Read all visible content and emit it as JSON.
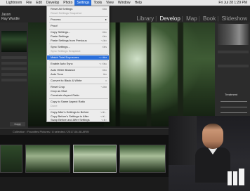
{
  "menubar": {
    "apple_glyph": "",
    "items": [
      {
        "label": "Lightroom",
        "active": false
      },
      {
        "label": "File",
        "active": false
      },
      {
        "label": "Edit",
        "active": false
      },
      {
        "label": "Develop",
        "active": false
      },
      {
        "label": "Photo",
        "active": false
      },
      {
        "label": "Settings",
        "active": true
      },
      {
        "label": "Tools",
        "active": false
      },
      {
        "label": "View",
        "active": false
      },
      {
        "label": "Window",
        "active": false
      },
      {
        "label": "Help",
        "active": false
      }
    ],
    "clock": "Fri Jul 28 1:29 PM"
  },
  "identity_plate": {
    "line1": "Jason",
    "line2": "Ray Wardle"
  },
  "modules": [
    "Library",
    "Develop",
    "Map",
    "Book",
    "Slideshow"
  ],
  "active_module": "Develop",
  "left_panel": {
    "button_label": "Copy"
  },
  "right_panel": {
    "label": "Treatment"
  },
  "filmstrip": {
    "info": "Collection : Favorites   Pictures / 8 selected / 2017-06-08.ARW"
  },
  "settings_menu": {
    "items": [
      {
        "label": "Reset All Settings",
        "shortcut": "⇧⌘R",
        "disabled": false
      },
      {
        "label": "Reset Settings Snapshot",
        "shortcut": "",
        "disabled": true
      },
      {
        "type": "separator"
      },
      {
        "label": "Process",
        "shortcut": "",
        "submenu": true,
        "disabled": false
      },
      {
        "type": "separator"
      },
      {
        "label": "Proof",
        "shortcut": "",
        "disabled": false
      },
      {
        "type": "separator"
      },
      {
        "label": "Copy Settings...",
        "shortcut": "⇧⌘C",
        "disabled": false
      },
      {
        "label": "Paste Settings",
        "shortcut": "⇧⌘V",
        "disabled": false
      },
      {
        "label": "Paste Settings from Previous",
        "shortcut": "⌥⌘V",
        "disabled": false
      },
      {
        "type": "separator"
      },
      {
        "label": "Sync Settings...",
        "shortcut": "⇧⌘S",
        "disabled": false
      },
      {
        "label": "Sync Settings Snapshot",
        "shortcut": "",
        "disabled": true
      },
      {
        "type": "separator"
      },
      {
        "label": "Match Total Exposures",
        "shortcut": "⌥⇧⌘M",
        "disabled": false,
        "highlighted": true
      },
      {
        "type": "separator"
      },
      {
        "label": "Enable Auto Sync",
        "shortcut": "⌥⇧⌘A",
        "disabled": false
      },
      {
        "type": "separator"
      },
      {
        "label": "Auto White Balance",
        "shortcut": "⇧⌘U",
        "disabled": false
      },
      {
        "label": "Auto Tone",
        "shortcut": "⌘U",
        "disabled": false
      },
      {
        "type": "separator"
      },
      {
        "label": "Convert to Black & White",
        "shortcut": "V",
        "disabled": false
      },
      {
        "type": "separator"
      },
      {
        "label": "Reset Crop",
        "shortcut": "⌥⌘R",
        "disabled": false
      },
      {
        "label": "Crop as Shot",
        "shortcut": "",
        "disabled": false
      },
      {
        "label": "Constrain Aspect Ratio",
        "shortcut": "",
        "disabled": false
      },
      {
        "type": "separator"
      },
      {
        "label": "Copy to Same Aspect Ratio",
        "shortcut": "",
        "disabled": false
      },
      {
        "label": "Done",
        "shortcut": "",
        "disabled": true
      },
      {
        "type": "separator"
      },
      {
        "label": "Copy After's Settings to Before",
        "shortcut": "⌥⌘←",
        "disabled": false
      },
      {
        "label": "Copy Before's Settings to After",
        "shortcut": "⌥⌘→",
        "disabled": false
      },
      {
        "label": "Swap Before and After Settings",
        "shortcut": "⌥⌘↑",
        "disabled": false
      }
    ]
  },
  "colors": {
    "menubar_bg": "#e6e6e6",
    "menu_highlight": "#2a6fdb",
    "app_bg": "#1a1a1a",
    "panel_bg": "#2c2c2c"
  }
}
